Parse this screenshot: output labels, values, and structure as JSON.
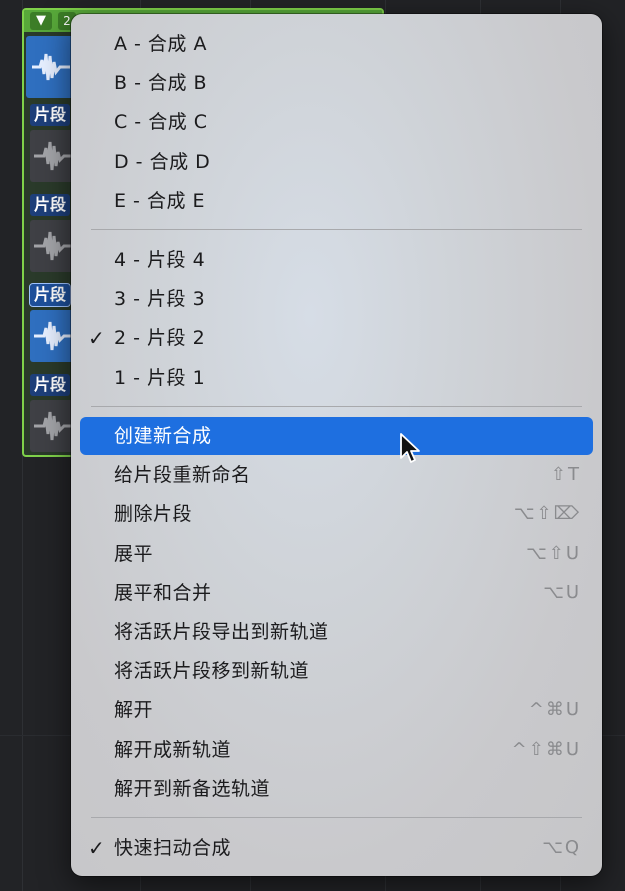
{
  "take_folder": {
    "header_number": "2",
    "takes": [
      {
        "label": "片段",
        "active": false
      },
      {
        "label": "片段",
        "active": false
      },
      {
        "label": "片段",
        "active": true
      },
      {
        "label": "片段",
        "active": false
      }
    ]
  },
  "menu": {
    "comps": [
      {
        "label": "A - 合成 A"
      },
      {
        "label": "B - 合成 B"
      },
      {
        "label": "C - 合成 C"
      },
      {
        "label": "D - 合成 D"
      },
      {
        "label": "E - 合成 E"
      }
    ],
    "takes": [
      {
        "label": "4 - 片段 4",
        "checked": false
      },
      {
        "label": "3 - 片段 3",
        "checked": false
      },
      {
        "label": "2 - 片段 2",
        "checked": true
      },
      {
        "label": "1 - 片段 1",
        "checked": false
      }
    ],
    "commands": [
      {
        "label": "创建新合成",
        "shortcut": "",
        "highlighted": true
      },
      {
        "label": "给片段重新命名",
        "shortcut": "⇧T"
      },
      {
        "label": "删除片段",
        "shortcut": "⌥⇧⌦"
      },
      {
        "label": "展平",
        "shortcut": "⌥⇧U"
      },
      {
        "label": "展平和合并",
        "shortcut": "⌥U"
      },
      {
        "label": "将活跃片段导出到新轨道",
        "shortcut": ""
      },
      {
        "label": "将活跃片段移到新轨道",
        "shortcut": ""
      },
      {
        "label": "解开",
        "shortcut": "^⌘U"
      },
      {
        "label": "解开成新轨道",
        "shortcut": "^⇧⌘U"
      },
      {
        "label": "解开到新备选轨道",
        "shortcut": ""
      }
    ],
    "quick_swipe": {
      "label": "快速扫动合成",
      "shortcut": "⌥Q",
      "checked": true
    },
    "check_glyph": "✓"
  },
  "colors": {
    "highlight": "#1e6fe0",
    "take_folder_border": "#7fd24a"
  }
}
